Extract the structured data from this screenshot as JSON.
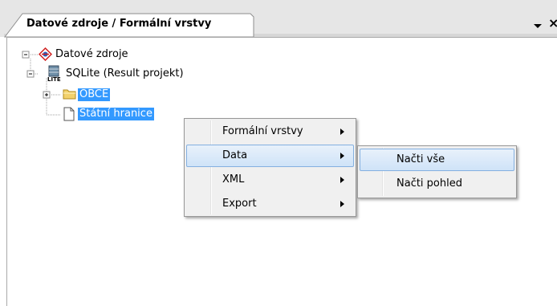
{
  "panel": {
    "title": "Datové zdroje / Formální vrstvy"
  },
  "tree": {
    "root": {
      "label": "Datové zdroje",
      "icon": "datasource-icon"
    },
    "database": {
      "label": "SQLite (Result projekt)",
      "icon": "sqlite-database-icon",
      "badge": "LITE"
    },
    "items": [
      {
        "label": "OBCE",
        "icon": "folder-icon",
        "selected": true
      },
      {
        "label": "Státní hranice",
        "icon": "file-icon",
        "selected": true
      }
    ]
  },
  "context_menu": {
    "items": [
      {
        "label": "Formální vrstvy",
        "has_submenu": true
      },
      {
        "label": "Data",
        "has_submenu": true,
        "highlighted": true
      },
      {
        "label": "XML",
        "has_submenu": true
      },
      {
        "label": "Export",
        "has_submenu": true
      }
    ]
  },
  "submenu": {
    "items": [
      {
        "label": "Načti vše",
        "highlighted": true
      },
      {
        "label": "Načti pohled"
      }
    ]
  },
  "colors": {
    "selection": "#3399ff",
    "menu_highlight_border": "#84b0e0",
    "menu_background": "#f0f0f0"
  }
}
